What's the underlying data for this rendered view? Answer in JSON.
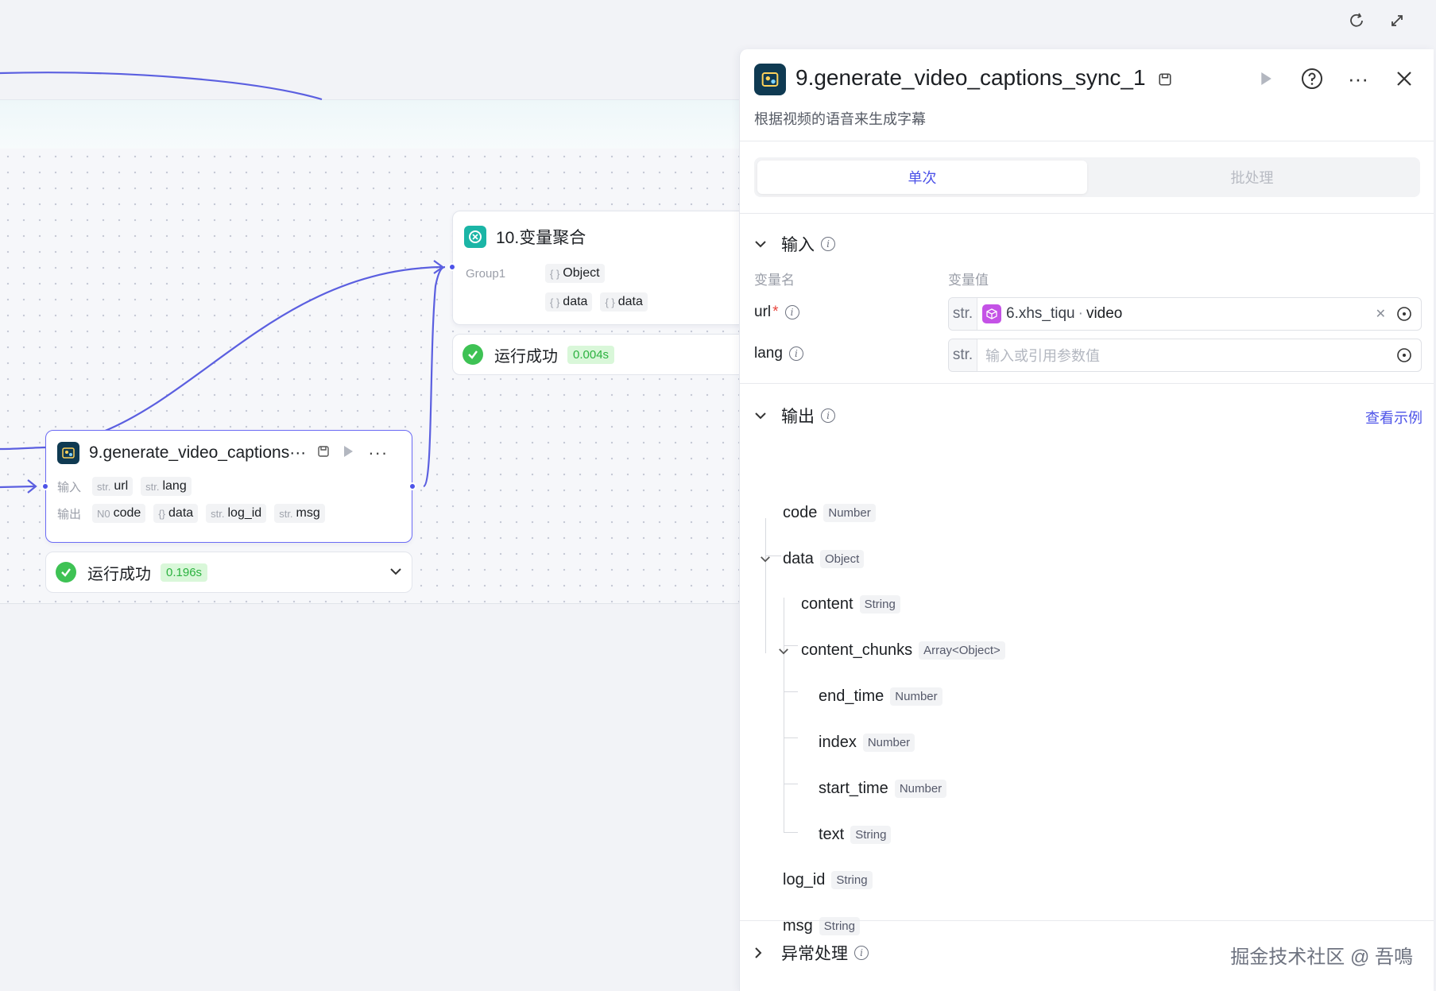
{
  "canvas": {
    "group_node": {
      "title": "10.变量聚合",
      "group_label": "Group1",
      "group_type": "Object",
      "vars": [
        "data",
        "data"
      ],
      "status": "运行成功",
      "time": "0.004s"
    },
    "plugin_node": {
      "title": "9.generate_video_captions···",
      "input_label": "输入",
      "inputs": [
        {
          "type": "str.",
          "name": "url"
        },
        {
          "type": "str.",
          "name": "lang"
        }
      ],
      "output_label": "输出",
      "outputs": [
        {
          "type": "N0",
          "name": "code"
        },
        {
          "type": "{}",
          "name": "data"
        },
        {
          "type": "str.",
          "name": "log_id"
        },
        {
          "type": "str.",
          "name": "msg"
        }
      ],
      "status": "运行成功",
      "time": "0.196s"
    }
  },
  "panel": {
    "title": "9.generate_video_captions_sync_1",
    "description": "根据视频的语音来生成字幕",
    "tabs": [
      {
        "label": "单次",
        "active": true
      },
      {
        "label": "批处理",
        "active": false
      }
    ],
    "input_section": {
      "title": "输入",
      "col_name": "变量名",
      "col_value": "变量值",
      "params": [
        {
          "name": "url",
          "required": true,
          "type": "str.",
          "ref_node": "6.xhs_tiqu",
          "ref_var": "video",
          "placeholder": ""
        },
        {
          "name": "lang",
          "required": false,
          "type": "str.",
          "ref_node": "",
          "ref_var": "",
          "placeholder": "输入或引用参数值"
        }
      ]
    },
    "output_section": {
      "title": "输出",
      "example_link": "查看示例",
      "fields": {
        "code": {
          "name": "code",
          "type": "Number"
        },
        "data": {
          "name": "data",
          "type": "Object"
        },
        "content": {
          "name": "content",
          "type": "String"
        },
        "content_chunks": {
          "name": "content_chunks",
          "type": "Array<Object>"
        },
        "end_time": {
          "name": "end_time",
          "type": "Number"
        },
        "index": {
          "name": "index",
          "type": "Number"
        },
        "start_time": {
          "name": "start_time",
          "type": "Number"
        },
        "text": {
          "name": "text",
          "type": "String"
        },
        "log_id": {
          "name": "log_id",
          "type": "String"
        },
        "msg": {
          "name": "msg",
          "type": "String"
        }
      }
    },
    "error_section": {
      "title": "异常处理"
    }
  },
  "watermark": "掘金技术社区 @ 吾鳴",
  "colors": {
    "accent": "#4d53e8",
    "success": "#3ec254",
    "plugin_icon_bg": "#0f3a52",
    "group_icon_bg": "#1bb5a6",
    "ref_icon_bg": "#c452e6"
  },
  "icons": [
    "refresh-icon",
    "fullscreen-icon",
    "run-icon",
    "help-icon",
    "more-icon",
    "close-icon",
    "plugin-icon",
    "aggregate-icon",
    "info-icon",
    "chevron-down-icon",
    "target-icon"
  ]
}
